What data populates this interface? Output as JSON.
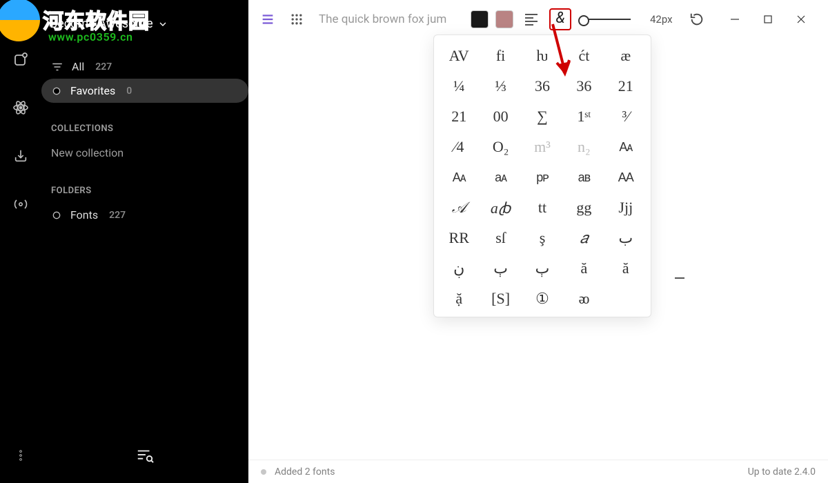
{
  "watermark": {
    "text1": "河东软件园",
    "text2": "www.pc0359.cn"
  },
  "brand": {
    "title": "Become Awesome"
  },
  "sidebar": {
    "items": [
      {
        "label": "All",
        "count": "227"
      },
      {
        "label": "Favorites",
        "count": "0"
      }
    ],
    "collections_heading": "COLLECTIONS",
    "new_collection_label": "New collection",
    "folders_heading": "FOLDERS",
    "folders": [
      {
        "label": "Fonts",
        "count": "227"
      }
    ]
  },
  "toolbar": {
    "sample_text": "The quick brown fox jum",
    "foreground_color": "#1a1a1a",
    "background_color": "#b98383",
    "size_label": "42px"
  },
  "glyphs": {
    "rows": [
      [
        "AV",
        "fi",
        "ƕ",
        "ćt",
        "æ"
      ],
      [
        "¼",
        "⅓",
        "36",
        "36",
        "21"
      ],
      [
        "21",
        "00",
        "∑",
        "1ˢᵗ",
        "³⁄"
      ],
      [
        "⁄4",
        "O₂",
        "m³",
        "n₂",
        "Aᴀ"
      ],
      [
        "Aᴀ",
        "aᴀ",
        "pᴘ",
        "aʙ",
        "AA"
      ],
      [
        "𝒜",
        "aꞗ",
        "tt",
        "gg",
        "Jjj"
      ],
      [
        "RR",
        "sſ",
        "ş",
        "𝑎",
        "ب"
      ],
      [
        "ڹ",
        "ٻ",
        "ٻ",
        "ă",
        "ă"
      ],
      [
        "ặ",
        "[S]",
        "①",
        "ᴔ",
        ""
      ]
    ]
  },
  "statusbar": {
    "message": "Added 2 fonts",
    "version": "Up to date 2.4.0"
  }
}
